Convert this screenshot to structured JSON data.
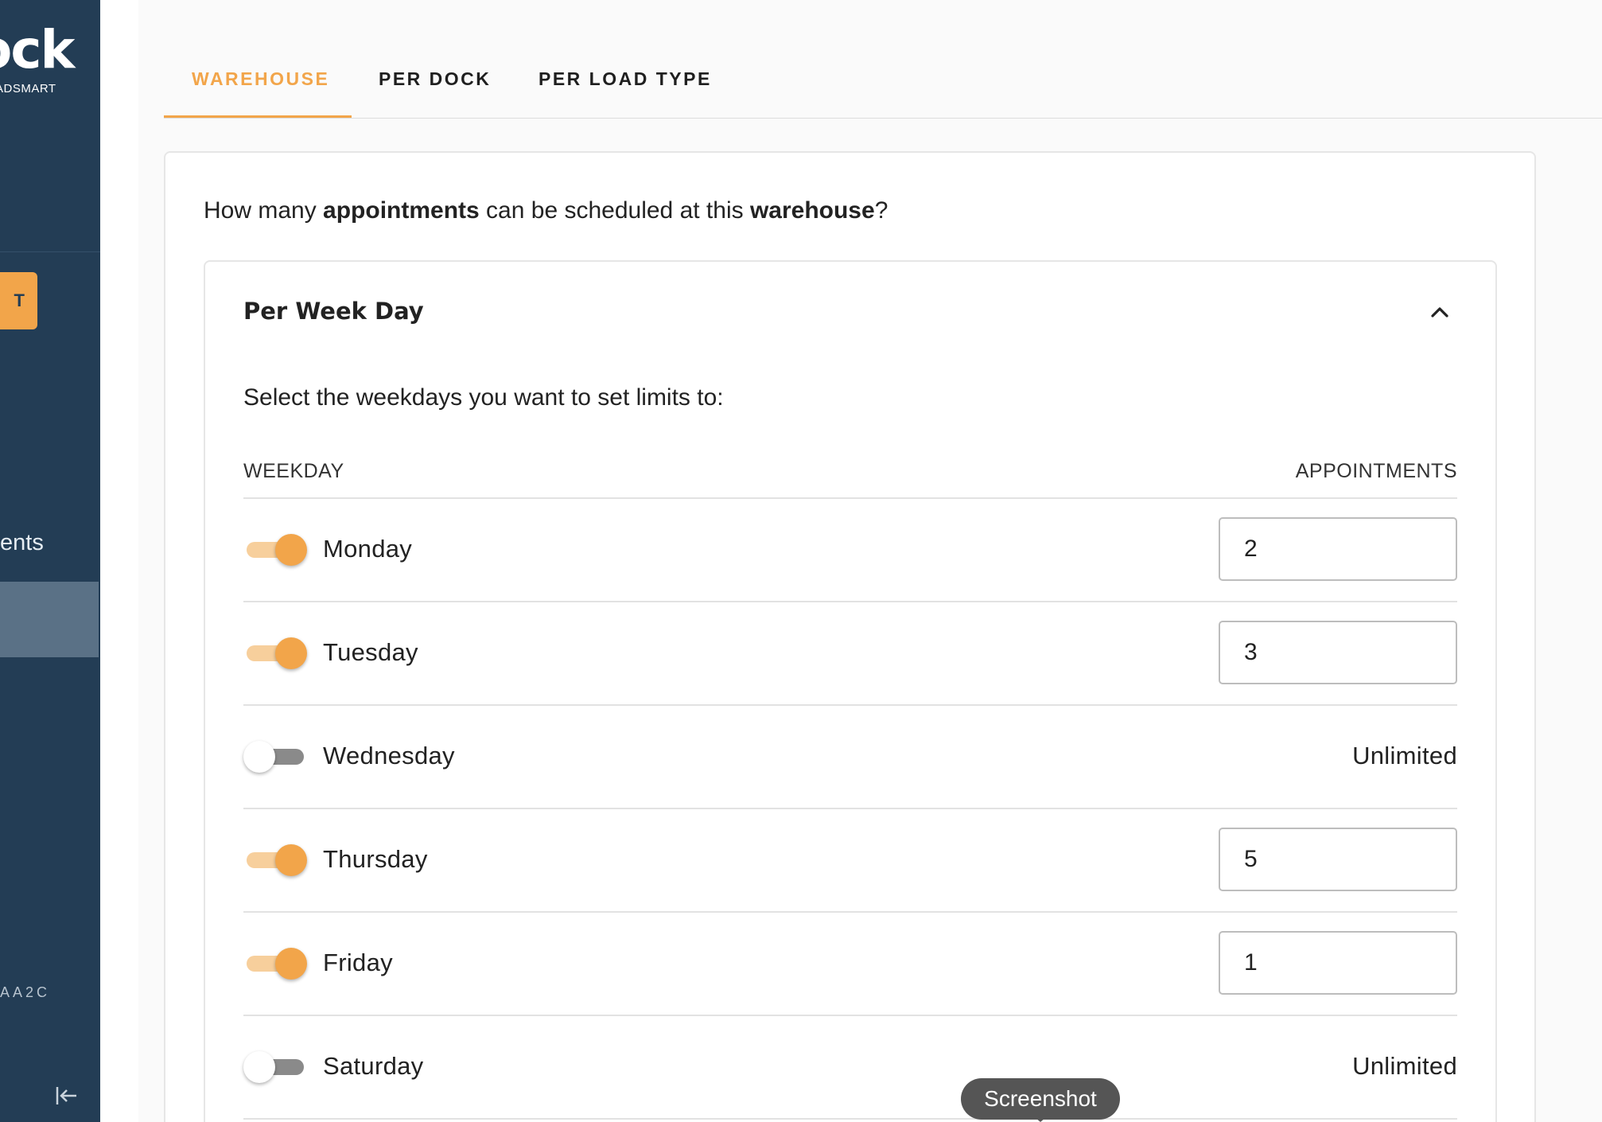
{
  "sidebar": {
    "logo_text": "ock",
    "logo_subtitle": "ADSMART",
    "primary_button_label": "T",
    "nav_label": "ents",
    "footer_code": "AA2C",
    "collapse_icon": "collapse-left-icon"
  },
  "tabs": [
    {
      "label": "WAREHOUSE",
      "active": true
    },
    {
      "label": "PER DOCK",
      "active": false
    },
    {
      "label": "PER LOAD TYPE",
      "active": false
    }
  ],
  "question": {
    "part1": "How many ",
    "bold1": "appointments",
    "part2": " can be scheduled at this ",
    "bold2": "warehouse",
    "part3": "?"
  },
  "section": {
    "title": "Per Week Day",
    "expanded": true,
    "chevron_icon": "chevron-up-icon",
    "instruction": "Select the weekdays you want to set limits to:",
    "columns": {
      "weekday": "WEEKDAY",
      "appointments": "APPOINTMENTS"
    },
    "days": [
      {
        "name": "Monday",
        "enabled": true,
        "value": "2"
      },
      {
        "name": "Tuesday",
        "enabled": true,
        "value": "3"
      },
      {
        "name": "Wednesday",
        "enabled": false,
        "value": "Unlimited"
      },
      {
        "name": "Thursday",
        "enabled": true,
        "value": "5"
      },
      {
        "name": "Friday",
        "enabled": true,
        "value": "1"
      },
      {
        "name": "Saturday",
        "enabled": false,
        "value": "Unlimited"
      }
    ]
  },
  "tooltip": {
    "label": "Screenshot"
  },
  "colors": {
    "accent": "#f2a54a",
    "sidebar_bg": "#233d55",
    "sidebar_active": "#5a7186",
    "toggle_off_track": "#8a8a8a"
  }
}
